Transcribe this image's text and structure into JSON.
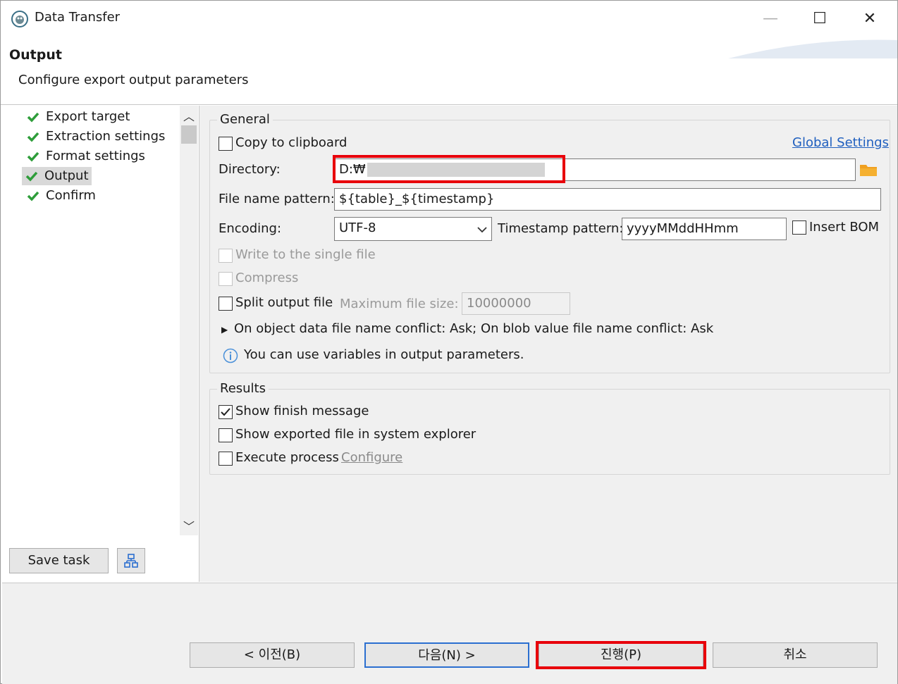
{
  "window": {
    "title": "Data Transfer",
    "minimize": "—",
    "maximize": "☐",
    "close": "✕"
  },
  "header": {
    "title": "Output",
    "description": "Configure export output parameters"
  },
  "nav": {
    "items": [
      {
        "label": "Export target"
      },
      {
        "label": "Extraction settings"
      },
      {
        "label": "Format settings"
      },
      {
        "label": "Output",
        "selected": true
      },
      {
        "label": "Confirm"
      }
    ],
    "save_task": "Save task",
    "scroll_up": "︿",
    "scroll_down": "﹀"
  },
  "general": {
    "group_title": "General",
    "copy_to_clipboard": "Copy to clipboard",
    "global_settings": "Global Settings",
    "directory_label": "Directory:",
    "directory_value": "D:₩",
    "file_name_pattern_label": "File name pattern:",
    "file_name_pattern_value": "${table}_${timestamp}",
    "encoding_label": "Encoding:",
    "encoding_value": "UTF-8",
    "timestamp_pattern_label": "Timestamp pattern:",
    "timestamp_pattern_value": "yyyyMMddHHmm",
    "insert_bom": "Insert BOM",
    "write_single_file": "Write to the single file",
    "compress": "Compress",
    "split_output_file": "Split output file",
    "max_file_size_label": "Maximum file size:",
    "max_file_size_value": "10000000",
    "conflict_text": "On object data file name conflict: Ask; On blob value file name conflict: Ask",
    "info_text": "You can use variables in output parameters.",
    "expander": "▶"
  },
  "results": {
    "group_title": "Results",
    "show_finish_message": "Show finish message",
    "show_finish_checked": true,
    "show_exported_file": "Show exported file in system explorer",
    "execute_process": "Execute process",
    "configure": "Configure"
  },
  "footer": {
    "prev": "< 이전(B)",
    "next": "다음(N) >",
    "proceed": "진행(P)",
    "cancel": "취소"
  },
  "colors": {
    "highlight": "#e8000b",
    "check_green": "#2e9d3a",
    "link": "#1f5fbf",
    "folder": "#f0a020"
  }
}
